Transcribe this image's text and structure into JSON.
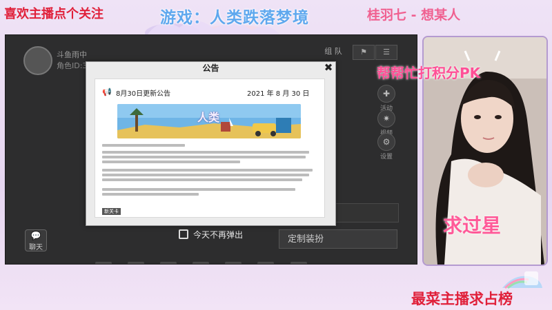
{
  "overlay": {
    "follow_text": "喜欢主播点个关注",
    "game_title": "游戏：人类跌落梦境",
    "song_text": "桂羽七 - 想某人",
    "pk_text": "帮帮忙打积分PK",
    "star_text": "求过星",
    "rank_text": "最菜主播求占榜"
  },
  "game": {
    "player_name": "斗鱼雨中",
    "player_id_label": "角色ID:3",
    "team_label": "组 队",
    "side_buttons": [
      {
        "icon": "activity-icon",
        "label": "活动"
      },
      {
        "icon": "settings-cog-icon",
        "label": "视频"
      },
      {
        "icon": "gear-icon",
        "label": "设置"
      }
    ],
    "chat_label": "聊天",
    "outfit_label": "定制装扮",
    "no_show_label": "今天不再弹出"
  },
  "dialog": {
    "title": "公告",
    "close_glyph": "✖",
    "notice_title": "8月30日更新公告",
    "notice_date": "2021 年 8 月 30 日",
    "banner_text": "人类",
    "tag_label": "新关卡"
  },
  "colors": {
    "overlay_red": "#e0203a",
    "title_blue": "#5fa8ee",
    "pink": "#ff5a98",
    "game_bg": "#2d2d2e"
  }
}
